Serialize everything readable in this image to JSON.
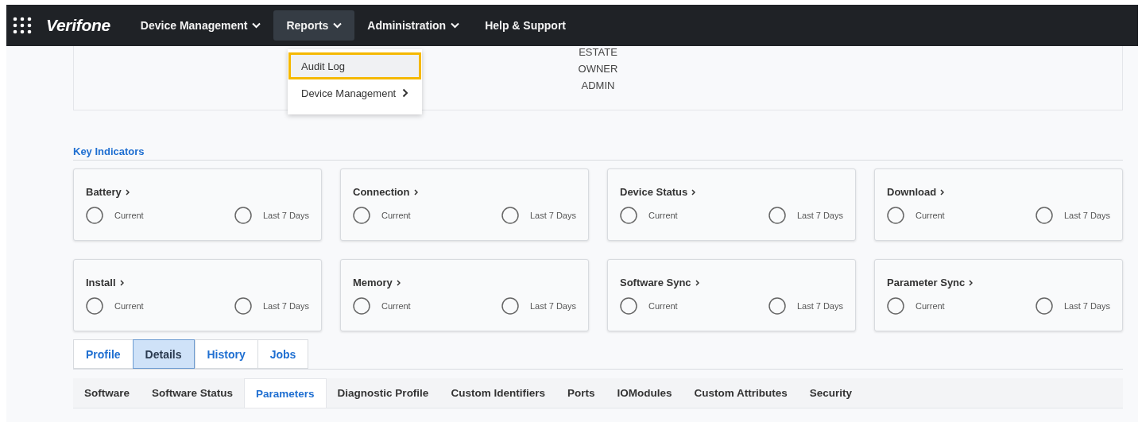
{
  "navbar": {
    "logo": "Verifone",
    "items": [
      {
        "label": "Device Management",
        "dropdown": true,
        "selected": false
      },
      {
        "label": "Reports",
        "dropdown": true,
        "selected": true
      },
      {
        "label": "Administration",
        "dropdown": true,
        "selected": false
      },
      {
        "label": "Help & Support",
        "dropdown": false,
        "selected": false
      }
    ]
  },
  "reports_menu": {
    "items": [
      {
        "label": "Audit Log",
        "focused": true,
        "submenu": false
      },
      {
        "label": "Device Management",
        "focused": false,
        "submenu": true
      }
    ]
  },
  "info_panel": {
    "lines": [
      "ESTATE",
      "OWNER",
      "ADMIN"
    ]
  },
  "key_indicators": {
    "title": "Key Indicators",
    "cards": [
      {
        "title": "Battery",
        "current": "Current",
        "last": "Last 7 Days"
      },
      {
        "title": "Connection",
        "current": "Current",
        "last": "Last 7 Days"
      },
      {
        "title": "Device Status",
        "current": "Current",
        "last": "Last 7 Days"
      },
      {
        "title": "Download",
        "current": "Current",
        "last": "Last 7 Days"
      },
      {
        "title": "Install",
        "current": "Current",
        "last": "Last 7 Days"
      },
      {
        "title": "Memory",
        "current": "Current",
        "last": "Last 7 Days"
      },
      {
        "title": "Software Sync",
        "current": "Current",
        "last": "Last 7 Days"
      },
      {
        "title": "Parameter Sync",
        "current": "Current",
        "last": "Last 7 Days"
      }
    ]
  },
  "tabs": [
    {
      "label": "Profile",
      "selected": false
    },
    {
      "label": "Details",
      "selected": true
    },
    {
      "label": "History",
      "selected": false
    },
    {
      "label": "Jobs",
      "selected": false
    }
  ],
  "subtabs": [
    {
      "label": "Software",
      "selected": false
    },
    {
      "label": "Software Status",
      "selected": false
    },
    {
      "label": "Parameters",
      "selected": true
    },
    {
      "label": "Diagnostic Profile",
      "selected": false
    },
    {
      "label": "Custom Identifiers",
      "selected": false
    },
    {
      "label": "Ports",
      "selected": false
    },
    {
      "label": "IOModules",
      "selected": false
    },
    {
      "label": "Custom Attributes",
      "selected": false
    },
    {
      "label": "Security",
      "selected": false
    }
  ]
}
